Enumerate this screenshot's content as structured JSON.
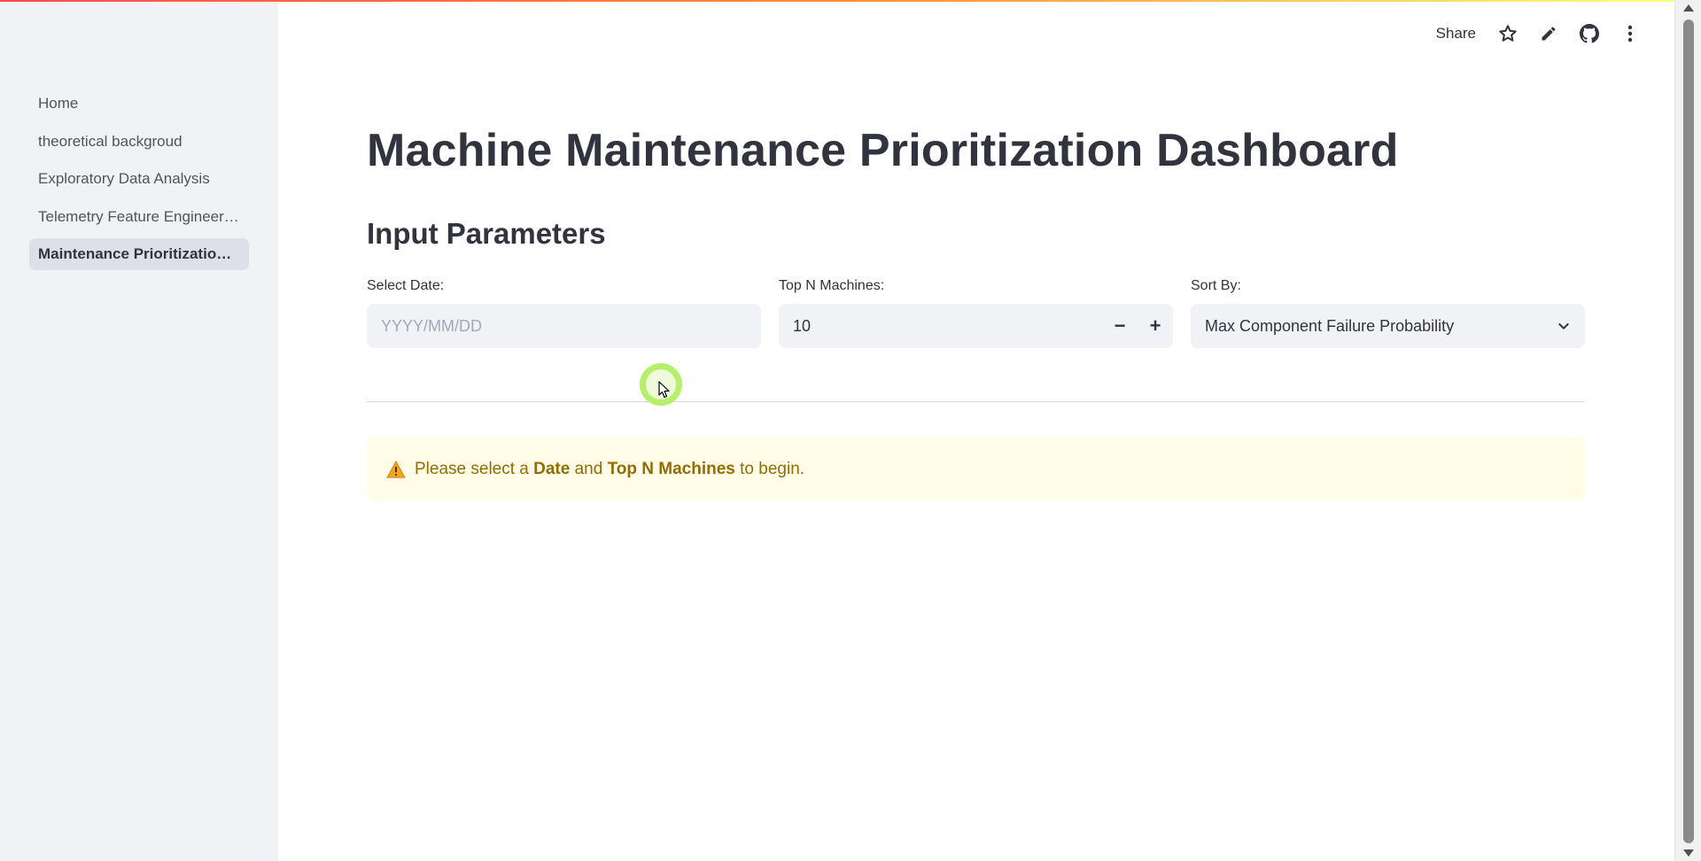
{
  "sidebar": {
    "items": [
      {
        "label": "Home",
        "active": false
      },
      {
        "label": "theoretical backgroud",
        "active": false
      },
      {
        "label": "Exploratory Data Analysis",
        "active": false
      },
      {
        "label": "Telemetry Feature Engineering",
        "active": false
      },
      {
        "label": "Maintenance Prioritization ...",
        "active": true
      }
    ]
  },
  "toolbar": {
    "share_label": "Share",
    "icons": [
      "star-icon",
      "pencil-icon",
      "github-icon",
      "more-vertical-icon"
    ]
  },
  "main": {
    "title": "Machine Maintenance Prioritization Dashboard",
    "section_title": "Input Parameters",
    "date_field": {
      "label": "Select Date:",
      "placeholder": "YYYY/MM/DD",
      "value": ""
    },
    "top_n_field": {
      "label": "Top N Machines:",
      "value": "10",
      "decrement": "−",
      "increment": "+"
    },
    "sort_field": {
      "label": "Sort By:",
      "value": "Max Component Failure Probability"
    },
    "warning": {
      "prefix": "Please select a ",
      "date_word": "Date",
      "middle": " and ",
      "top_n_word": "Top N Machines",
      "suffix": " to begin."
    }
  },
  "colors": {
    "sidebar_bg": "#f0f2f6",
    "active_item_bg": "#dde0e8",
    "text": "#31333f",
    "warning_bg": "#fffde7",
    "warning_text": "#926c05",
    "cursor_highlight": "#b6ef6a"
  }
}
